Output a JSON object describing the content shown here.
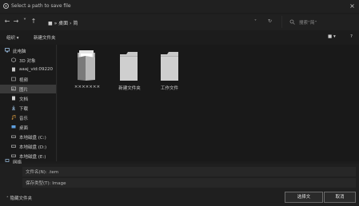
{
  "window": {
    "title": "Select a path to save file",
    "close_glyph": "×"
  },
  "address": {
    "back": "←",
    "forward": "→",
    "up_arrow": "˅",
    "up": "↑",
    "path": "■ » 桌面 › 简",
    "dropdown": "˅",
    "refresh": "↻",
    "search_placeholder": "搜索“简”"
  },
  "toolbar": {
    "organize": "组织 ▾",
    "new_folder": "新建文件夹",
    "view_glyph": "■ ▾",
    "help_glyph": "?"
  },
  "sidebar": {
    "items": [
      {
        "label": "此电脑",
        "icon": "pc-icon"
      },
      {
        "label": "3D 对象",
        "icon": "cube-icon"
      },
      {
        "label": "aaaj_vid:09220",
        "icon": "video-icon"
      },
      {
        "label": "视频",
        "icon": "video-icon"
      },
      {
        "label": "图片",
        "icon": "image-icon"
      },
      {
        "label": "文档",
        "icon": "document-icon"
      },
      {
        "label": "下载",
        "icon": "download-icon"
      },
      {
        "label": "音乐",
        "icon": "music-icon"
      },
      {
        "label": "桌面",
        "icon": "desktop-icon"
      },
      {
        "label": "本地磁盘 (C:)",
        "icon": "drive-icon"
      },
      {
        "label": "本地磁盘 (D:)",
        "icon": "drive-icon"
      },
      {
        "label": "本地磁盘 (E:)",
        "icon": "drive-icon"
      },
      {
        "label": "网络",
        "icon": "network-icon"
      }
    ]
  },
  "folders": [
    {
      "label": "×××××××"
    },
    {
      "label": "新建文件夹"
    },
    {
      "label": "工作文件"
    }
  ],
  "footer": {
    "filename_label": "文件名(N): .tem",
    "filetype_label": "保存类型(T): Image",
    "hide_folders": "˄ 隐藏文件夹",
    "save_button": "选择文",
    "cancel_button": "取消"
  }
}
